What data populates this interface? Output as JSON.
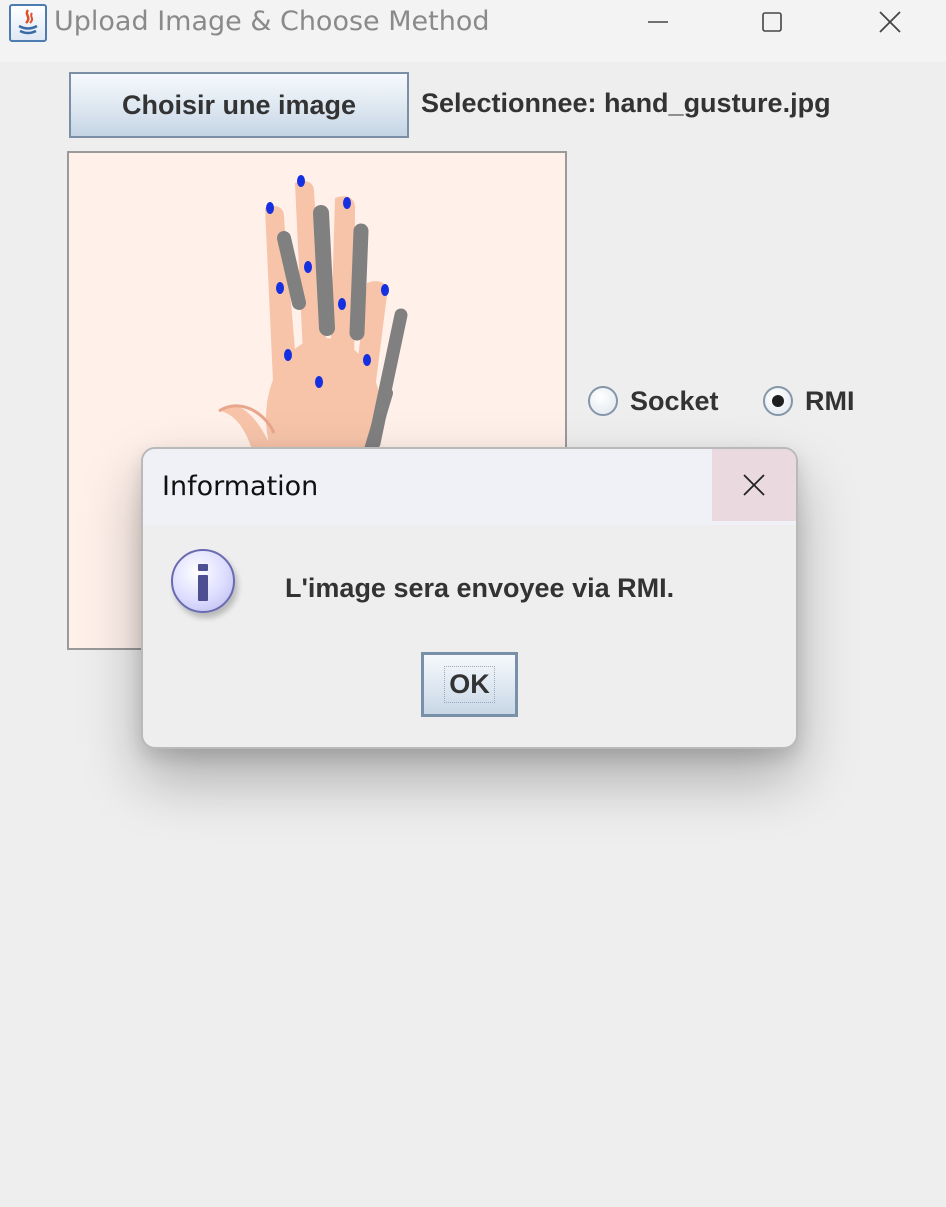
{
  "window": {
    "title": "Upload Image & Choose Method",
    "icon": "java-app-icon",
    "controls": [
      "minimize-icon",
      "maximize-icon",
      "close-icon"
    ]
  },
  "main": {
    "choose_button_label": "Choisir une image",
    "selected_label": "Selectionnee: hand_gusture.jpg",
    "preview_image": "hand-gesture-landmarks-image",
    "method_options": [
      {
        "label": "Socket",
        "selected": false
      },
      {
        "label": "RMI",
        "selected": true
      }
    ]
  },
  "dialog": {
    "title": "Information",
    "icon": "info-icon",
    "message": "L'image sera envoyee via RMI.",
    "ok_label": "OK"
  },
  "colors": {
    "preview_background": "#fff0ea",
    "skin": "#f7c4a9",
    "landmark": "#1530e0",
    "dialog_close_hover": "#ead9de"
  }
}
